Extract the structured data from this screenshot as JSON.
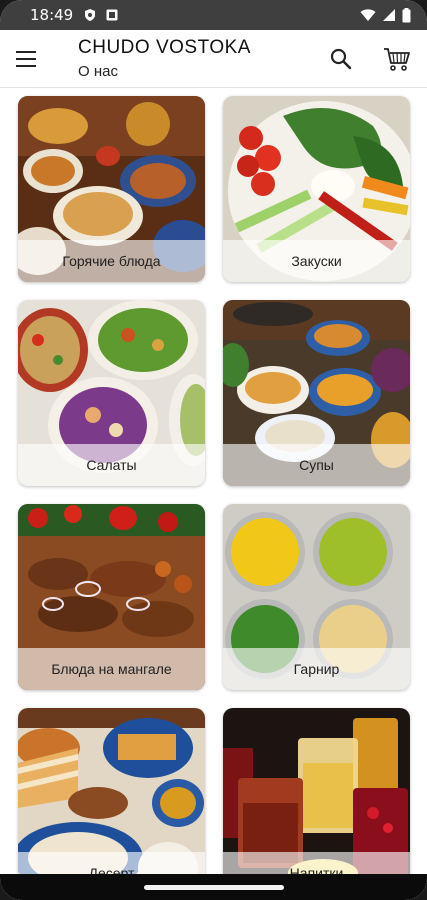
{
  "status_bar": {
    "time": "18:49"
  },
  "header": {
    "title": "CHUDO VOSTOKA",
    "subtitle": "О нас"
  },
  "icons": {
    "menu": "menu-icon",
    "search": "search-icon",
    "cart": "cart-icon",
    "wifi": "wifi-icon",
    "signal": "signal-icon",
    "battery": "battery-icon"
  },
  "categories": [
    {
      "label": "Горячие блюда"
    },
    {
      "label": "Закуски"
    },
    {
      "label": "Салаты"
    },
    {
      "label": "Супы"
    },
    {
      "label": "Блюда на мангале"
    },
    {
      "label": "Гарнир"
    },
    {
      "label": "Десерт"
    },
    {
      "label": "Напитки"
    }
  ]
}
